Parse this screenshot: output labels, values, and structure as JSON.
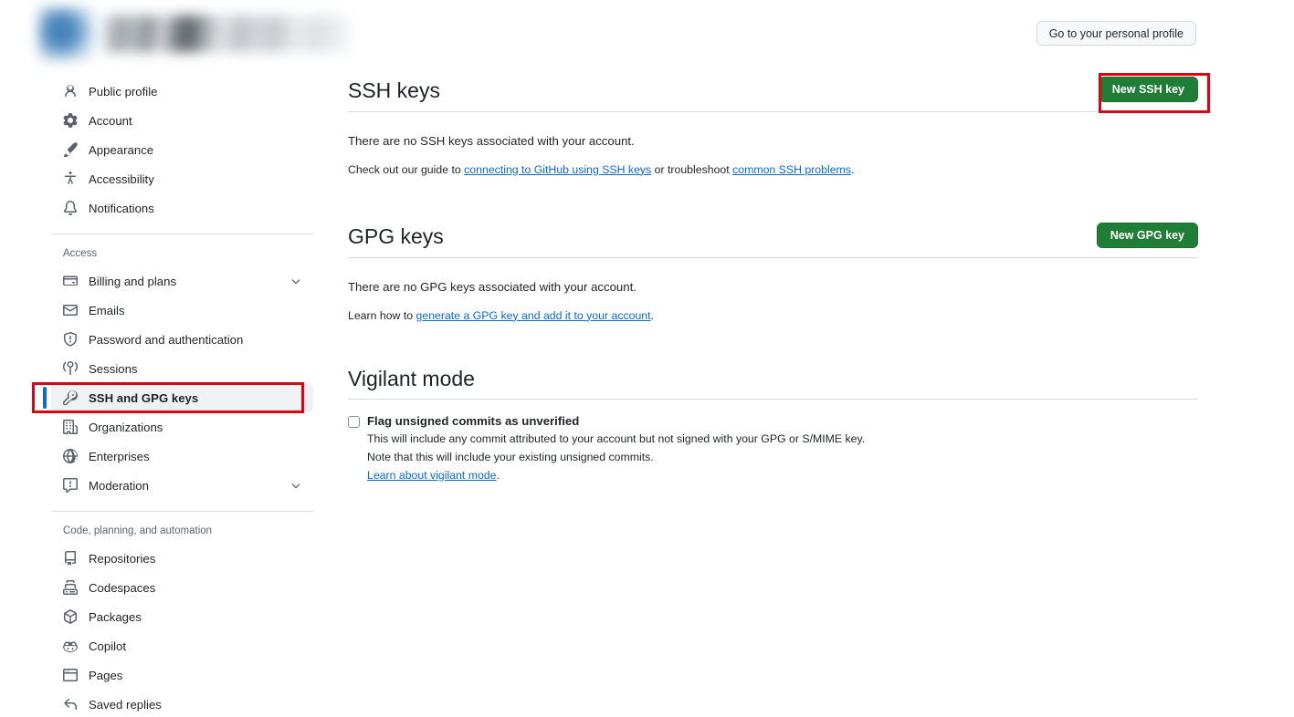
{
  "header": {
    "profile_button": "Go to your personal profile",
    "identity_blurred": true
  },
  "sidebar": {
    "groups": [
      {
        "title": null,
        "items": [
          {
            "label": "Public profile",
            "icon": "person-icon",
            "chevron": false,
            "selected": false
          },
          {
            "label": "Account",
            "icon": "gear-icon",
            "chevron": false,
            "selected": false
          },
          {
            "label": "Appearance",
            "icon": "paintbrush-icon",
            "chevron": false,
            "selected": false
          },
          {
            "label": "Accessibility",
            "icon": "accessibility-icon",
            "chevron": false,
            "selected": false
          },
          {
            "label": "Notifications",
            "icon": "bell-icon",
            "chevron": false,
            "selected": false
          }
        ]
      },
      {
        "title": "Access",
        "items": [
          {
            "label": "Billing and plans",
            "icon": "credit-card-icon",
            "chevron": true,
            "selected": false
          },
          {
            "label": "Emails",
            "icon": "mail-icon",
            "chevron": false,
            "selected": false
          },
          {
            "label": "Password and authentication",
            "icon": "shield-icon",
            "chevron": false,
            "selected": false
          },
          {
            "label": "Sessions",
            "icon": "broadcast-icon",
            "chevron": false,
            "selected": false
          },
          {
            "label": "SSH and GPG keys",
            "icon": "key-icon",
            "chevron": false,
            "selected": true
          },
          {
            "label": "Organizations",
            "icon": "organization-icon",
            "chevron": false,
            "selected": false
          },
          {
            "label": "Enterprises",
            "icon": "globe-icon",
            "chevron": false,
            "selected": false
          },
          {
            "label": "Moderation",
            "icon": "report-icon",
            "chevron": true,
            "selected": false
          }
        ]
      },
      {
        "title": "Code, planning, and automation",
        "items": [
          {
            "label": "Repositories",
            "icon": "repo-icon",
            "chevron": false,
            "selected": false
          },
          {
            "label": "Codespaces",
            "icon": "codespaces-icon",
            "chevron": false,
            "selected": false
          },
          {
            "label": "Packages",
            "icon": "package-icon",
            "chevron": false,
            "selected": false
          },
          {
            "label": "Copilot",
            "icon": "copilot-icon",
            "chevron": false,
            "selected": false
          },
          {
            "label": "Pages",
            "icon": "browser-icon",
            "chevron": false,
            "selected": false
          },
          {
            "label": "Saved replies",
            "icon": "reply-icon",
            "chevron": false,
            "selected": false
          }
        ]
      }
    ]
  },
  "main": {
    "ssh": {
      "title": "SSH keys",
      "button": "New SSH key",
      "empty_text": "There are no SSH keys associated with your account.",
      "guide_prefix": "Check out our guide to ",
      "guide_link": "connecting to GitHub using SSH keys",
      "guide_middle": " or troubleshoot ",
      "guide_link2": "common SSH problems",
      "guide_suffix": "."
    },
    "gpg": {
      "title": "GPG keys",
      "button": "New GPG key",
      "empty_text": "There are no GPG keys associated with your account.",
      "learn_prefix": "Learn how to ",
      "learn_link": "generate a GPG key and add it to your account",
      "learn_suffix": "."
    },
    "vigilant": {
      "title": "Vigilant mode",
      "checkbox_label": "Flag unsigned commits as unverified",
      "checkbox_checked": false,
      "desc_line1": "This will include any commit attributed to your account but not signed with your GPG or S/MIME key.",
      "desc_line2": "Note that this will include your existing unsigned commits.",
      "learn_link": "Learn about vigilant mode",
      "learn_suffix": "."
    }
  },
  "annotations": {
    "color": "#e3000f",
    "boxes": [
      "sidebar-ssh-and-gpg-keys",
      "new-ssh-key-button"
    ]
  },
  "colors": {
    "accent_green": "#1f7d36",
    "link_blue": "#0969da",
    "selected_bar": "#0969da",
    "selected_bg": "#f0f1f2",
    "annotation_red": "#e3000f"
  }
}
